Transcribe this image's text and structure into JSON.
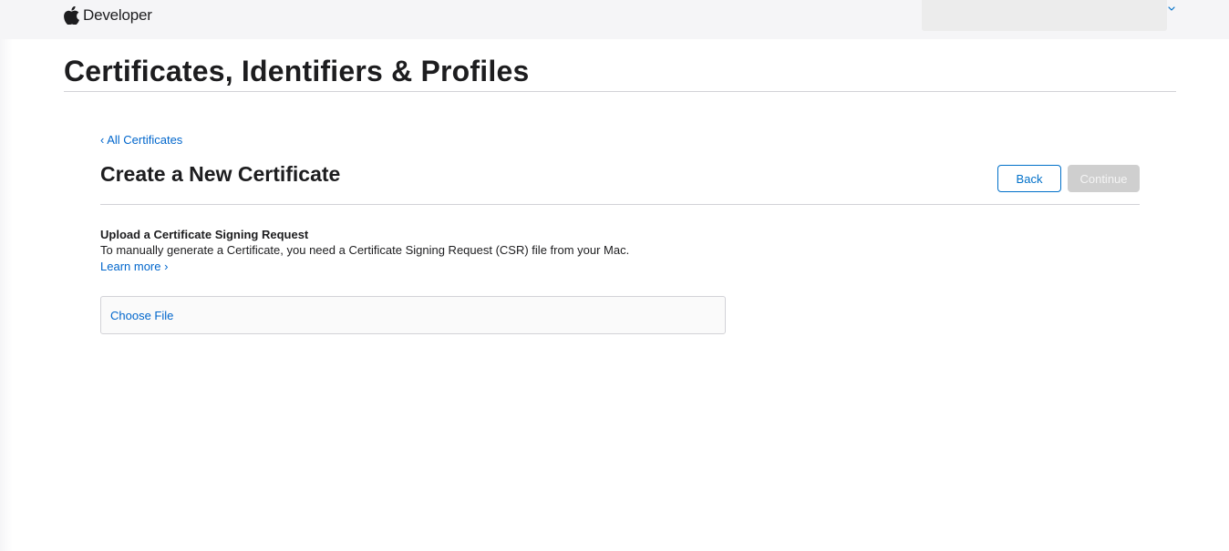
{
  "nav": {
    "brand_label": "Developer",
    "account_menu_icon": "chevron-down-icon"
  },
  "header": {
    "title": "Certificates, Identifiers & Profiles"
  },
  "content": {
    "breadcrumb": "‹ All Certificates",
    "title": "Create a New Certificate",
    "back_label": "Back",
    "continue_label": "Continue",
    "upload_heading": "Upload a Certificate Signing Request",
    "upload_description": "To manually generate a Certificate, you need a Certificate Signing Request (CSR) file from your Mac.",
    "learn_more": "Learn more ›",
    "choose_file_label": "Choose File"
  },
  "colors": {
    "link": "#0066cc",
    "button_border": "#0070c9",
    "disabled_button": "#cfcfcf",
    "nav_background": "#f5f5f7"
  }
}
